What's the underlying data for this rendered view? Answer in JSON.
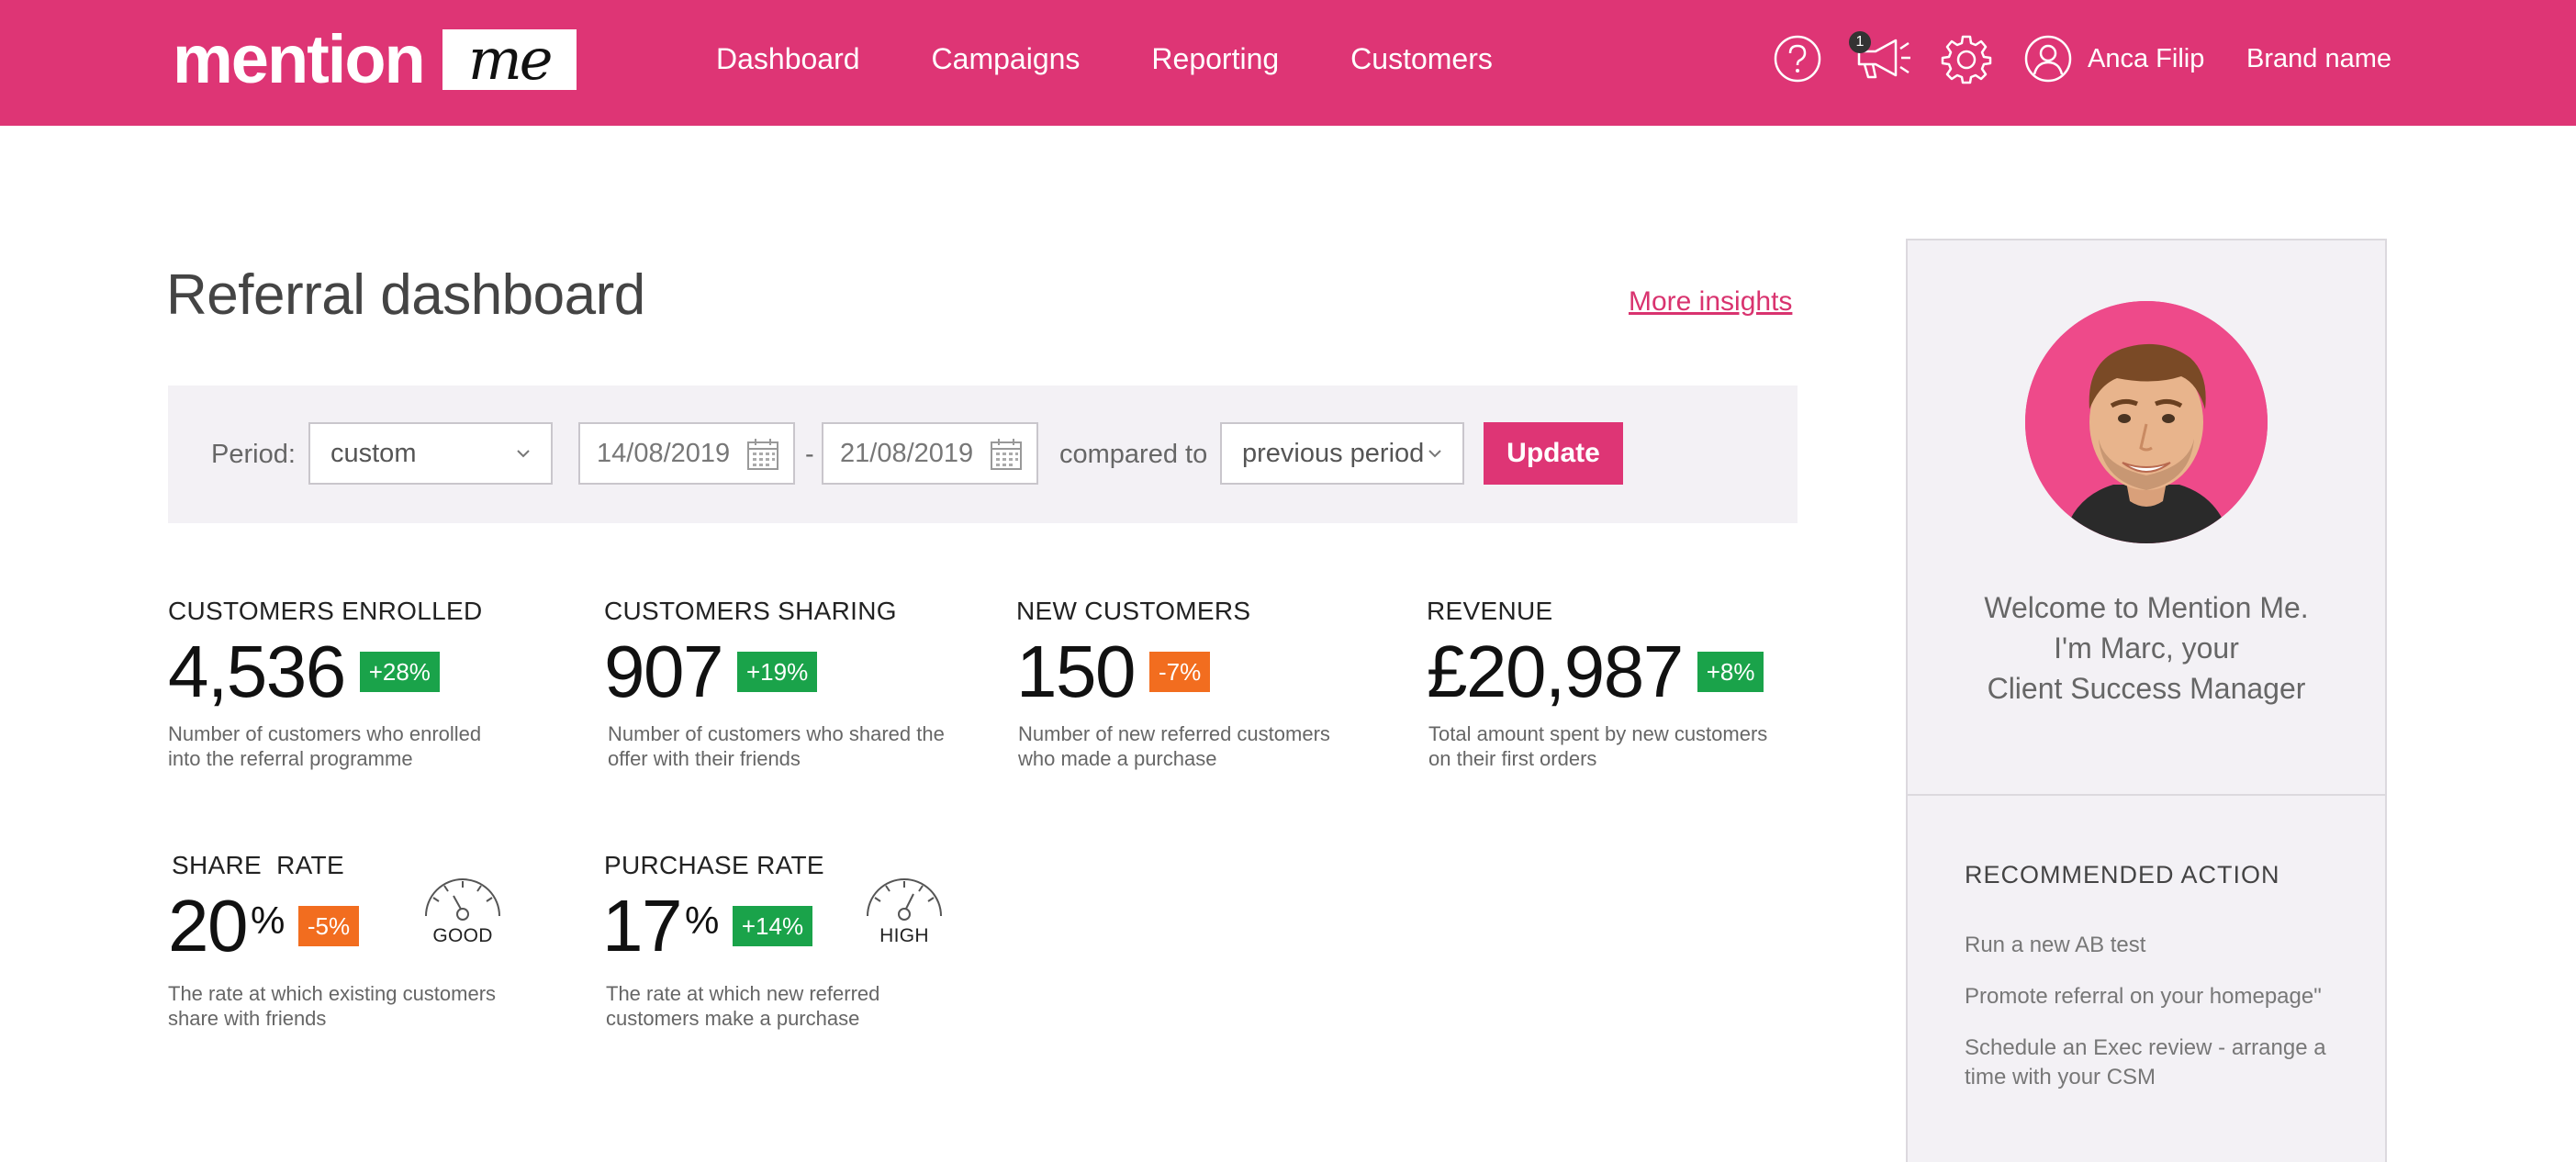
{
  "header": {
    "logo_text": "mention",
    "logo_box_text": "me",
    "nav": [
      "Dashboard",
      "Campaigns",
      "Reporting",
      "Customers"
    ],
    "notification_count": "1",
    "user_name": "Anca Filip",
    "brand_name": "Brand name"
  },
  "page": {
    "title": "Referral dashboard",
    "more_insights": "More insights"
  },
  "filter": {
    "period_label": "Period:",
    "period_value": "custom",
    "start_date": "14/08/2019",
    "separator": "-",
    "end_date": "21/08/2019",
    "compared_label": "compared to",
    "compared_value": "previous period",
    "update_label": "Update"
  },
  "metrics": {
    "enrolled": {
      "title": "CUSTOMERS ENROLLED",
      "value": "4,536",
      "change": "+28%",
      "desc": "Number of customers who enrolled into the referral programme"
    },
    "sharing": {
      "title": "CUSTOMERS SHARING",
      "value": "907",
      "change": "+19%",
      "desc": "Number of customers who shared the offer with their friends"
    },
    "new_customers": {
      "title": "NEW CUSTOMERS",
      "value": "150",
      "change": "-7%",
      "desc": "Number of new referred customers who made a purchase"
    },
    "revenue": {
      "title": "REVENUE",
      "value": "£20,987",
      "change": "+8%",
      "desc": "Total amount spent by new customers on their first orders"
    },
    "share_rate": {
      "title": "SHARE  RATE",
      "value": "20",
      "unit": "%",
      "change": "-5%",
      "gauge_label": "GOOD",
      "desc": "The rate at which existing customers share with friends"
    },
    "purchase_rate": {
      "title": "PURCHASE RATE",
      "value": "17",
      "unit": "%",
      "change": "+14%",
      "gauge_label": "HIGH",
      "desc": "The rate at which new referred customers make a purchase"
    }
  },
  "panel": {
    "welcome_lines": [
      "Welcome to Mention Me.",
      "I'm Marc, your",
      "Client Success Manager"
    ],
    "recommended_title": "RECOMMENDED ACTION",
    "actions": [
      "Run a new AB test",
      "Promote referral on your homepage\"",
      "Schedule an Exec review - arrange a time with your CSM"
    ]
  },
  "colors": {
    "brand": "#de3575",
    "positive": "#1aa34a",
    "negative": "#f26d1f",
    "panel_bg": "#f3f1f5"
  },
  "icons": [
    "help-icon",
    "megaphone-icon",
    "gear-icon",
    "user-icon",
    "chevron-down-icon",
    "calendar-icon",
    "gauge-icon"
  ]
}
